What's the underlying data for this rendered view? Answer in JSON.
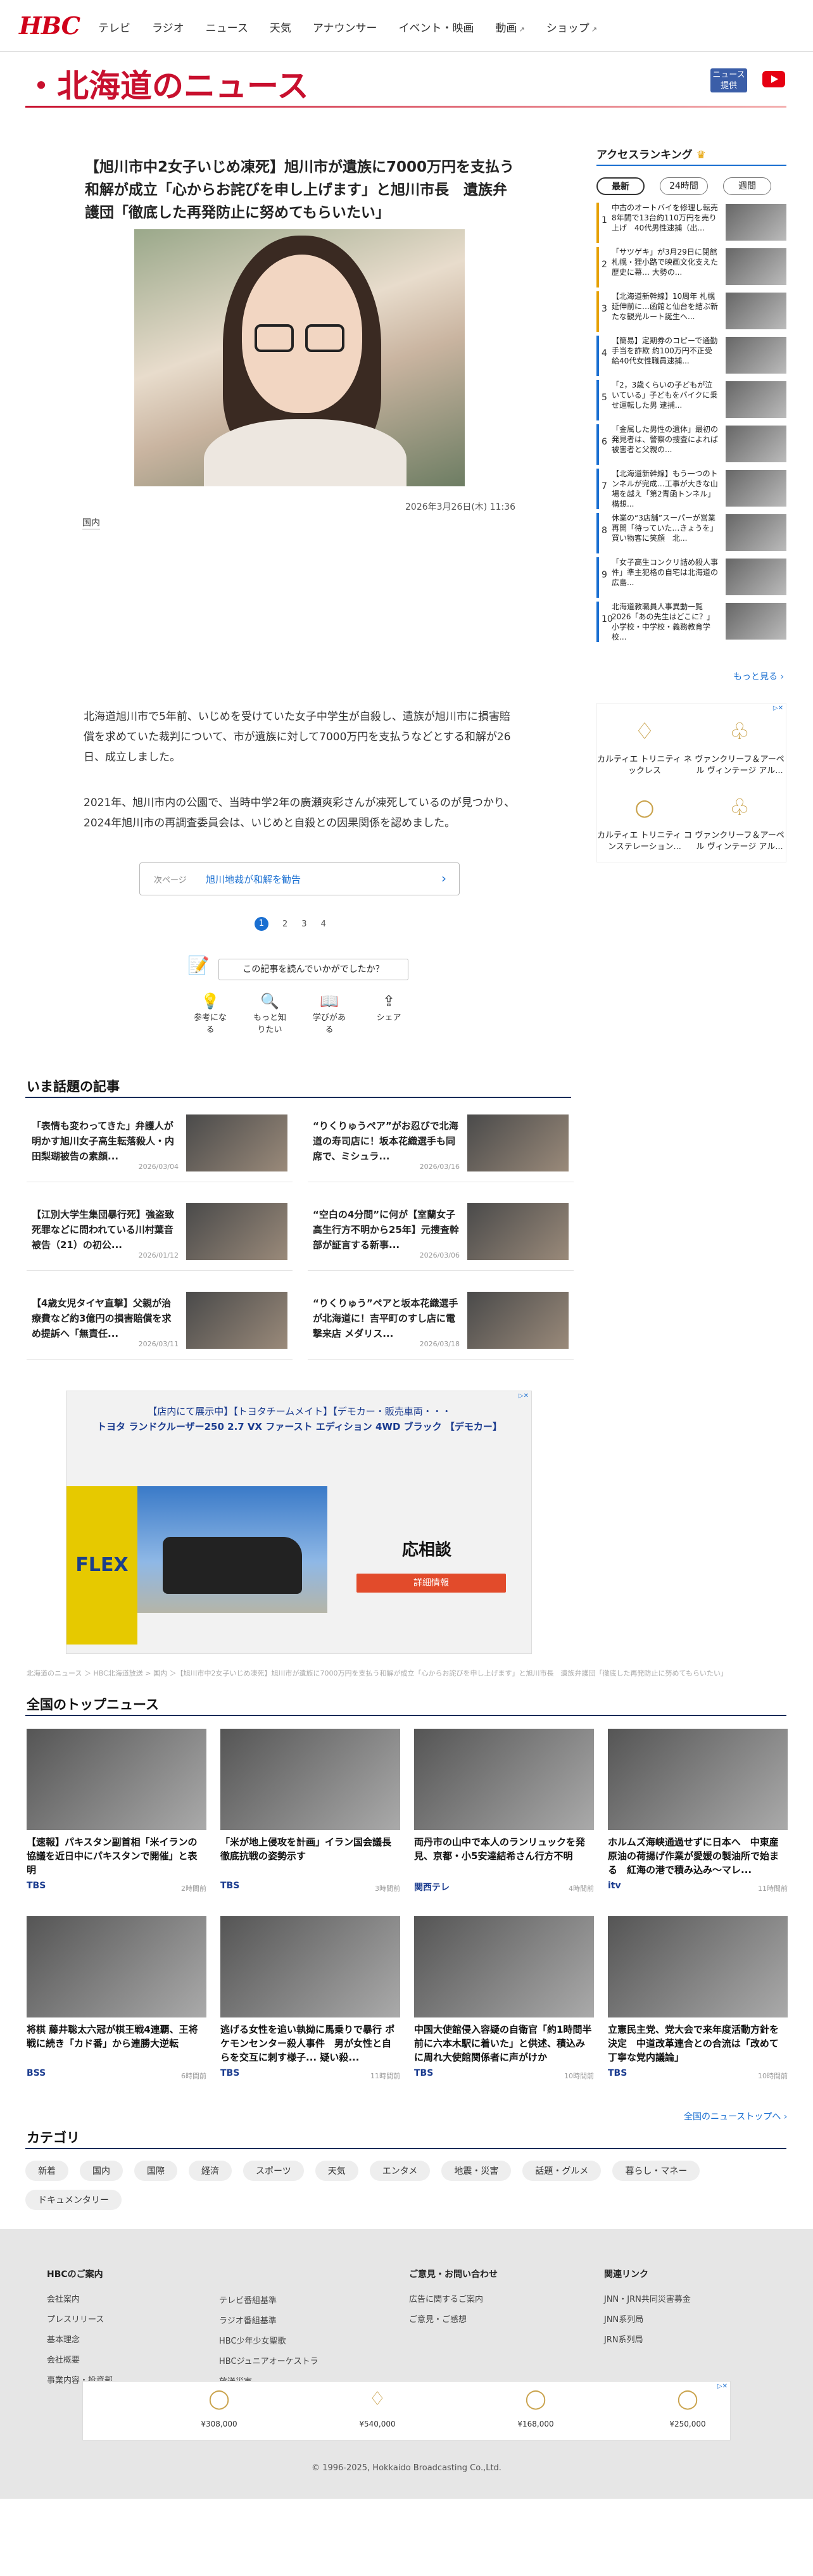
{
  "header": {
    "logo": "HBC",
    "nav": [
      "テレビ",
      "ラジオ",
      "ニュース",
      "天気",
      "アナウンサー",
      "イベント・映画",
      "動画",
      "ショップ"
    ],
    "page_title": "北海道のニュース",
    "news_badge": "ニュース 提供"
  },
  "article": {
    "title": "【旭川市中2女子いじめ凍死】旭川市が遺族に7000万円を支払う和解が成立「心からお詫びを申し上げます」と旭川市長　遺族弁護団「徹底した再発防止に努めてもらいたい」",
    "date": "2026年3月26日(木) 11:36",
    "category": "国内",
    "paragraph1": "北海道旭川市で5年前、いじめを受けていた女子中学生が自殺し、遺族が旭川市に損害賠償を求めていた裁判について、市が遺族に対して7000万円を支払うなどとする和解が26日、成立しました。",
    "paragraph2": "2021年、旭川市内の公園で、当時中学2年の廣瀬爽彩さんが凍死しているのが見つかり、2024年旭川市の再調査委員会は、いじめと自殺との因果関係を認めました。",
    "next_label": "次ページ",
    "next_title": "旭川地裁が和解を勧告",
    "pages": [
      "1",
      "2",
      "3",
      "4"
    ],
    "survey": "この記事を読んでいかがでしたか？",
    "reactions": [
      "参考になる",
      "もっと知りたい",
      "学びがある",
      "シェア"
    ]
  },
  "ranking": {
    "heading": "アクセスランキング",
    "tabs": [
      "最新",
      "24時間",
      "週間"
    ],
    "items": [
      {
        "n": "1",
        "text": "中古のオートバイを修理し転売8年間で13台約110万円を売り上げ　40代男性逮捕（出..."
      },
      {
        "n": "2",
        "text": "「サツゲキ」が3月29日に閉館　札幌・狸小路で映画文化支えた歴史に幕… 大勢の..."
      },
      {
        "n": "3",
        "text": "【北海道新幹線】10周年 札幌延伸前に…函館と仙台を結ぶ新たな観光ルート誕生へ..."
      },
      {
        "n": "4",
        "text": "【簡易】定期券のコピーで通勤手当を詐欺 約100万円不正受給40代女性職員逮捕..."
      },
      {
        "n": "5",
        "text": "「2，3歳くらいの子どもが泣いている」子どもをバイクに乗せ運転した男 逮捕..."
      },
      {
        "n": "6",
        "text": "「金属した男性の遺体」最初の発見者は、警察の捜査によれば被害者と父親の..."
      },
      {
        "n": "7",
        "text": "【北海道新幹線】もう一つのトンネルが完成…工事が大きな山場を越え「第2青函トンネル」構想..."
      },
      {
        "n": "8",
        "text": "休業の“3店舗”スーパーが営業再開「待っていた…きょうを」買い物客に笑顔　北..."
      },
      {
        "n": "9",
        "text": "「女子高生コンクリ詰め殺人事件」準主犯格の自宅は北海道の広島..."
      },
      {
        "n": "10",
        "text": "北海道教職員人事異動一覧 2026「あの先生はどこに？」小学校・中学校・義務教育学校..."
      }
    ],
    "more": "もっと見る ›"
  },
  "side_ad": {
    "products": [
      "カルティエ トリニティ ネックレス",
      "ヴァンクリーフ＆アーペル ヴィンテージ アル...",
      "カルティエ トリニティ コンステレーション...",
      "ヴァンクリーフ＆アーペル ヴィンテージ アル..."
    ]
  },
  "popular": {
    "heading": "いま話題の記事",
    "items": [
      {
        "title": "「表情も変わってきた」弁護人が明かす旭川女子高生転落殺人・内田梨瑚被告の素顔...",
        "date": "2026/03/04"
      },
      {
        "title": "“りくりゅうペア”がお忍びで北海道の寿司店に！坂本花織選手も同席で、ミシュラ...",
        "date": "2026/03/16"
      },
      {
        "title": "【江別大学生集団暴行死】強盗致死罪などに問われている川村葉音被告（21）の初公...",
        "date": "2026/01/12"
      },
      {
        "title": "“空白の4分間”に何が【室蘭女子高生行方不明から25年】元捜査幹部が証言する新事...",
        "date": "2026/03/06"
      },
      {
        "title": "【4歳女児タイヤ直撃】父親が治療費など約3億円の損害賠償を求め提訴へ「無責任...",
        "date": "2026/03/11"
      },
      {
        "title": "“りくりゅう”ペアと坂本花織選手が北海道に！吉平町のすし店に電撃来店 メダリス...",
        "date": "2026/03/18"
      }
    ]
  },
  "ad_banner": {
    "line1": "【店内にて展示中】【トヨタチームメイト】【デモカー・販売車両・・・",
    "line2": "トヨタ ランドクルーザー250 2.7 VX ファースト エディション 4WD ブラック 【デモカー】",
    "brand": "FLEX",
    "cta": "応相談",
    "button": "詳細情報"
  },
  "breadcrumb": "北海道のニュース ＞ HBC北海道放送 > 国内 ＞【旭川市中2女子いじめ凍死】旭川市が遺族に7000万円を支払う和解が成立「心からお詫びを申し上げます」と旭川市長　遺族弁護団「徹底した再発防止に努めてもらいたい」",
  "topnews": {
    "heading": "全国のトップニュース",
    "items": [
      {
        "title": "【速報】パキスタン副首相「米イランの協議を近日中にパキスタンで開催」と表明",
        "source": "TBS",
        "time": "2時間前"
      },
      {
        "title": "「米が地上侵攻を計画」イラン国会議長　徹底抗戦の姿勢示す",
        "source": "TBS",
        "time": "3時間前"
      },
      {
        "title": "両丹市の山中で本人のランリュックを発見、京都・小5安達結希さん行方不明",
        "source": "関西テレ",
        "time": "4時間前"
      },
      {
        "title": "ホルムズ海峡通過せずに日本へ　中東産原油の荷揚げ作業が愛媛の製油所で始まる　紅海の港で積み込み〜マレ...",
        "source": "itv",
        "time": "11時間前"
      },
      {
        "title": "将棋 藤井聡太六冠が棋王戦4連覇、王将戦に続き「カド番」から連勝大逆転",
        "source": "BSS",
        "time": "6時間前"
      },
      {
        "title": "逃げる女性を追い執拗に馬乗りで暴行 ポケモンセンター殺人事件　男が女性と自らを交互に刺す様子... 疑い殺...",
        "source": "TBS",
        "time": "11時間前"
      },
      {
        "title": "中国大使館侵入容疑の自衛官「約1時間半前に六本木駅に着いた」と供述、積込みに周れ大使館関係者に声がけか",
        "source": "TBS",
        "time": "10時間前"
      },
      {
        "title": "立憲民主党、党大会で来年度活動方針を決定　中道改革連合との合流は「改めて丁寧な党内議論」",
        "source": "TBS",
        "time": "10時間前"
      }
    ],
    "more": "全国のニューストップへ ›"
  },
  "categories": {
    "heading": "カテゴリ",
    "items": [
      "新着",
      "国内",
      "国際",
      "経済",
      "スポーツ",
      "天気",
      "エンタメ",
      "地震・災害",
      "話題・グルメ",
      "暮らし・マネー",
      "ドキュメンタリー"
    ]
  },
  "footer": {
    "col1_title": "HBCのご案内",
    "col1": [
      "会社案内",
      "プレスリリース",
      "基本理念",
      "会社概要",
      "事業内容・投資部"
    ],
    "col2": [
      "テレビ番組基準",
      "ラジオ番組基準",
      "HBC少年少女聖歌",
      "HBCジュニアオーケストラ",
      "放送災害"
    ],
    "col3_title": "ご意見・お問い合わせ",
    "col3": [
      "広告に関するご案内",
      "ご意見・ご感想"
    ],
    "col4_title": "関連リンク",
    "col4": [
      "JNN・JRN共同災害募金",
      "JNN系列局",
      "JRN系列局"
    ],
    "ad_prices": [
      "¥308,000",
      "¥540,000",
      "¥168,000",
      "¥250,000"
    ],
    "copyright": "© 1996-2025, Hokkaido Broadcasting Co.,Ltd."
  },
  "colors": {
    "brand": "#c8102e",
    "nav_dark": "#1a2d5a",
    "link": "#1a6fd1"
  }
}
